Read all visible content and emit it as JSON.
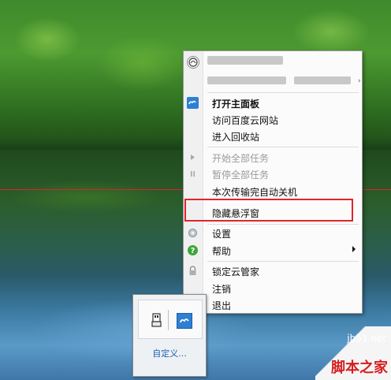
{
  "menu": {
    "items": [
      {
        "label": "打开主面板",
        "icon": "baidu-cloud-icon",
        "bold": true,
        "enabled": true
      },
      {
        "label": "访问百度云网站",
        "icon": "",
        "bold": false,
        "enabled": true
      },
      {
        "label": "进入回收站",
        "icon": "",
        "bold": false,
        "enabled": true
      },
      {
        "label": "开始全部任务",
        "icon": "play-icon",
        "bold": false,
        "enabled": false
      },
      {
        "label": "暂停全部任务",
        "icon": "pause-icon",
        "bold": false,
        "enabled": false
      },
      {
        "label": "本次传输完自动关机",
        "icon": "",
        "bold": false,
        "enabled": true
      },
      {
        "label": "隐藏悬浮窗",
        "icon": "",
        "bold": false,
        "enabled": true,
        "highlighted": true
      },
      {
        "label": "设置",
        "icon": "gear-icon",
        "bold": false,
        "enabled": true
      },
      {
        "label": "帮助",
        "icon": "help-icon",
        "bold": false,
        "enabled": true,
        "submenu": true
      },
      {
        "label": "锁定云管家",
        "icon": "lock-icon",
        "bold": false,
        "enabled": true
      },
      {
        "label": "注销",
        "icon": "",
        "bold": false,
        "enabled": true
      },
      {
        "label": "退出",
        "icon": "exit-icon",
        "bold": false,
        "enabled": true
      }
    ]
  },
  "tray": {
    "customize_label": "自定义..."
  },
  "watermark": {
    "site": "jb51.net",
    "name": "脚本之家"
  },
  "colors": {
    "highlight_border": "#e2242a",
    "link": "#1a5fb4"
  }
}
